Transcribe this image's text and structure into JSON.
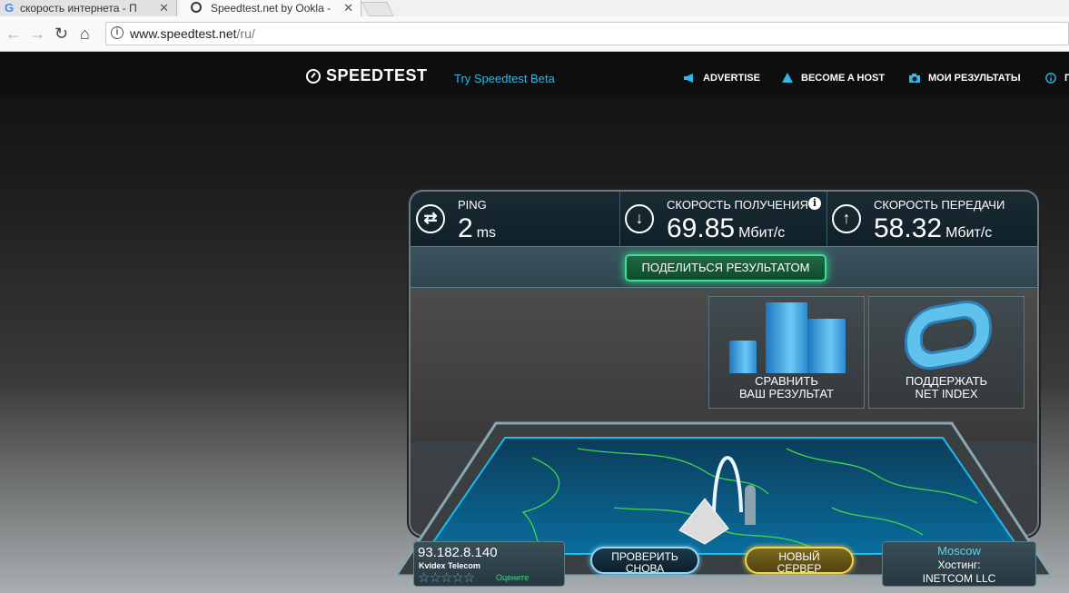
{
  "browser": {
    "tabs": [
      {
        "title": "скорость интернета - П",
        "active": false
      },
      {
        "title": "Speedtest.net by Ookla -",
        "active": true
      }
    ],
    "url_host": "www.speedtest.net",
    "url_path": "/ru/"
  },
  "header": {
    "logo_text": "SPEEDTEST",
    "beta_link": "Try Speedtest Beta",
    "nav": [
      {
        "label": "ADVERTISE",
        "icon": "megaphone-icon"
      },
      {
        "label": "BECOME A HOST",
        "icon": "host-icon"
      },
      {
        "label": "МОИ РЕЗУЛЬТАТЫ",
        "icon": "camera-icon"
      },
      {
        "label": "П",
        "icon": "info-icon"
      }
    ],
    "accent": "#32b8e6"
  },
  "results": {
    "ping": {
      "label": "PING",
      "value": "2",
      "unit": "ms"
    },
    "download": {
      "label": "СКОРОСТЬ ПОЛУЧЕНИЯ",
      "value": "69.85",
      "unit": "Мбит/с"
    },
    "upload": {
      "label": "СКОРОСТЬ ПЕРЕДАЧИ",
      "value": "58.32",
      "unit": "Мбит/с"
    }
  },
  "share_button": "ПОДЕЛИТЬСЯ РЕЗУЛЬТАТОМ",
  "tiles": [
    {
      "line1": "СРАВНИТЬ",
      "line2": "ВАШ РЕЗУЛЬТАТ"
    },
    {
      "line1": "ПОДДЕРЖАТЬ",
      "line2": "NET INDEX"
    }
  ],
  "client": {
    "ip": "93.182.8.140",
    "isp": "Kvidex Telecom",
    "rate_label": "Оцените",
    "stars": "☆☆☆☆☆"
  },
  "buttons": {
    "test_again_1": "ПРОВЕРИТЬ",
    "test_again_2": "СНОВА",
    "new_server_1": "НОВЫЙ",
    "new_server_2": "СЕРВЕР"
  },
  "server": {
    "city": "Moscow",
    "host_label": "Хостинг:",
    "host_name": "INETCOM LLC"
  },
  "colors": {
    "share_green": "#38e28e",
    "new_server_gold": "#f3d54d",
    "map_line_green": "#3fd64a"
  }
}
